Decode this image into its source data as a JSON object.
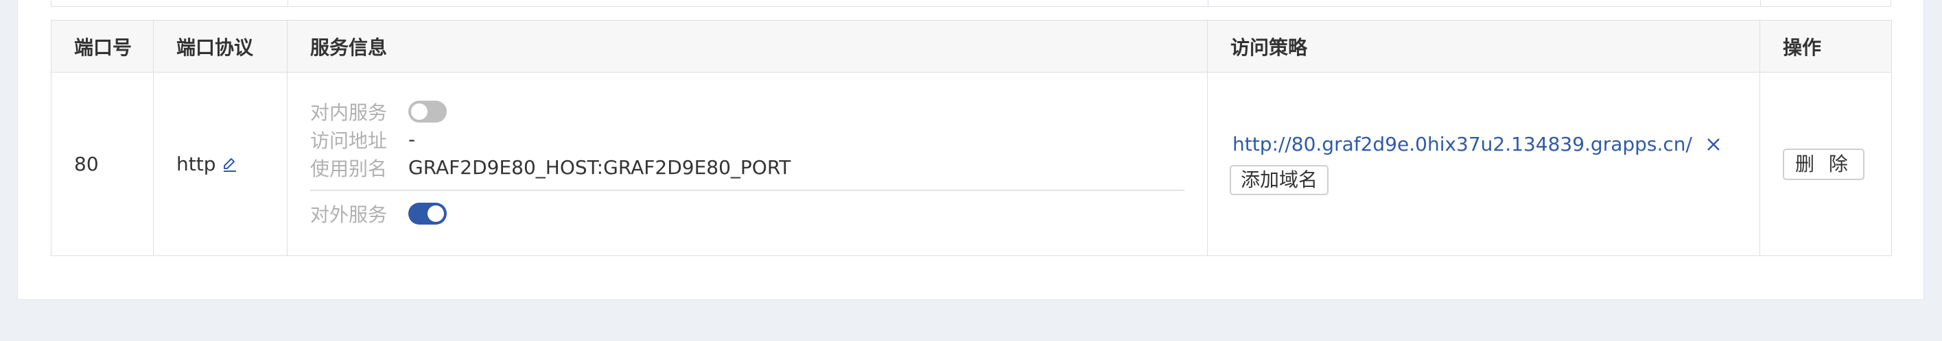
{
  "table": {
    "headers": {
      "port": "端口号",
      "protocol": "端口协议",
      "service_info": "服务信息",
      "access_policy": "访问策略",
      "actions": "操作"
    },
    "rows": [
      {
        "port": "80",
        "protocol": "http",
        "service": {
          "internal_label": "对内服务",
          "internal_enabled": false,
          "address_label": "访问地址",
          "address_value": "-",
          "alias_label": "使用别名",
          "alias_value": "GRAF2D9E80_HOST:GRAF2D9E80_PORT",
          "external_label": "对外服务",
          "external_enabled": true
        },
        "access": {
          "domain": "http://80.graf2d9e.0hix37u2.134839.grapps.cn/",
          "add_domain_label": "添加域名"
        },
        "actions": {
          "delete_label": "删 除"
        }
      }
    ]
  },
  "colors": {
    "accent": "#2f5aa8",
    "toggle_off": "#bfbfbf",
    "page_bg": "#edf0f4",
    "header_bg": "#f7f7f7"
  },
  "icons": {
    "edit": "pencil-icon",
    "remove": "close-icon"
  }
}
